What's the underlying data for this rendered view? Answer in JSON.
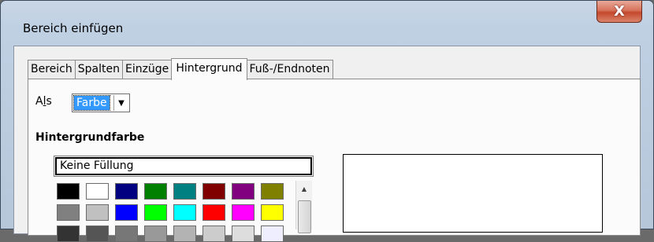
{
  "window": {
    "title": "Bereich einfügen",
    "close_symbol": "X"
  },
  "tabs": [
    {
      "label": "Bereich",
      "active": false
    },
    {
      "label": "Spalten",
      "active": false
    },
    {
      "label": "Einzüge",
      "active": false
    },
    {
      "label": "Hintergrund",
      "active": true
    },
    {
      "label": "Fuß-/Endnoten",
      "active": false
    }
  ],
  "background": {
    "as_label_pre": "A",
    "as_label_mnemonic": "l",
    "as_label_post": "s",
    "as_value": "Farbe",
    "section_title": "Hintergrundfarbe",
    "no_fill_label": "Keine Füllung"
  },
  "palette": {
    "row1": [
      "#000000",
      "#ffffff",
      "#000080",
      "#008000",
      "#008080",
      "#800000",
      "#800080",
      "#808000"
    ],
    "row2": [
      "#808080",
      "#c0c0c0",
      "#0000ff",
      "#00ff00",
      "#00ffff",
      "#ff0000",
      "#ff00ff",
      "#ffff00"
    ],
    "row3": [
      "#333333",
      "#555555",
      "#777777",
      "#999999",
      "#b3b3b3",
      "#cccccc",
      "#dddddd",
      "#eeeeff"
    ]
  },
  "colors": {
    "selection": "#3399ff",
    "close_button": "#c4482c"
  }
}
